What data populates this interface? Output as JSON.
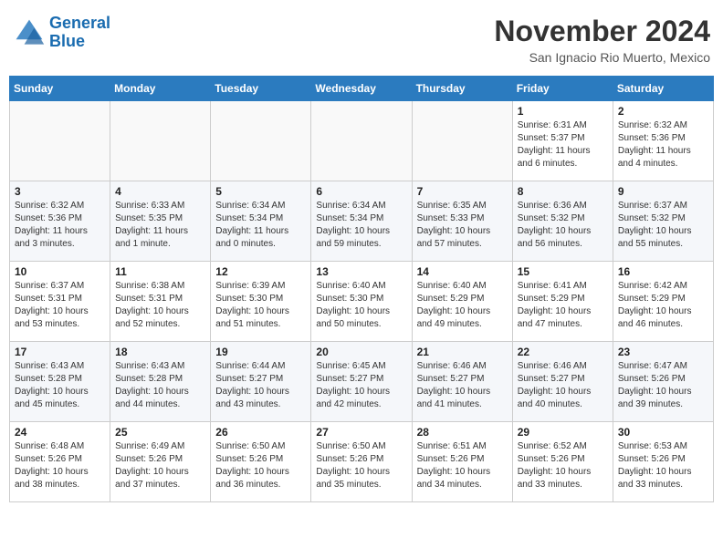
{
  "header": {
    "logo_line1": "General",
    "logo_line2": "Blue",
    "month": "November 2024",
    "location": "San Ignacio Rio Muerto, Mexico"
  },
  "weekdays": [
    "Sunday",
    "Monday",
    "Tuesday",
    "Wednesday",
    "Thursday",
    "Friday",
    "Saturday"
  ],
  "weeks": [
    [
      {
        "day": "",
        "info": ""
      },
      {
        "day": "",
        "info": ""
      },
      {
        "day": "",
        "info": ""
      },
      {
        "day": "",
        "info": ""
      },
      {
        "day": "",
        "info": ""
      },
      {
        "day": "1",
        "info": "Sunrise: 6:31 AM\nSunset: 5:37 PM\nDaylight: 11 hours and 6 minutes."
      },
      {
        "day": "2",
        "info": "Sunrise: 6:32 AM\nSunset: 5:36 PM\nDaylight: 11 hours and 4 minutes."
      }
    ],
    [
      {
        "day": "3",
        "info": "Sunrise: 6:32 AM\nSunset: 5:36 PM\nDaylight: 11 hours and 3 minutes."
      },
      {
        "day": "4",
        "info": "Sunrise: 6:33 AM\nSunset: 5:35 PM\nDaylight: 11 hours and 1 minute."
      },
      {
        "day": "5",
        "info": "Sunrise: 6:34 AM\nSunset: 5:34 PM\nDaylight: 11 hours and 0 minutes."
      },
      {
        "day": "6",
        "info": "Sunrise: 6:34 AM\nSunset: 5:34 PM\nDaylight: 10 hours and 59 minutes."
      },
      {
        "day": "7",
        "info": "Sunrise: 6:35 AM\nSunset: 5:33 PM\nDaylight: 10 hours and 57 minutes."
      },
      {
        "day": "8",
        "info": "Sunrise: 6:36 AM\nSunset: 5:32 PM\nDaylight: 10 hours and 56 minutes."
      },
      {
        "day": "9",
        "info": "Sunrise: 6:37 AM\nSunset: 5:32 PM\nDaylight: 10 hours and 55 minutes."
      }
    ],
    [
      {
        "day": "10",
        "info": "Sunrise: 6:37 AM\nSunset: 5:31 PM\nDaylight: 10 hours and 53 minutes."
      },
      {
        "day": "11",
        "info": "Sunrise: 6:38 AM\nSunset: 5:31 PM\nDaylight: 10 hours and 52 minutes."
      },
      {
        "day": "12",
        "info": "Sunrise: 6:39 AM\nSunset: 5:30 PM\nDaylight: 10 hours and 51 minutes."
      },
      {
        "day": "13",
        "info": "Sunrise: 6:40 AM\nSunset: 5:30 PM\nDaylight: 10 hours and 50 minutes."
      },
      {
        "day": "14",
        "info": "Sunrise: 6:40 AM\nSunset: 5:29 PM\nDaylight: 10 hours and 49 minutes."
      },
      {
        "day": "15",
        "info": "Sunrise: 6:41 AM\nSunset: 5:29 PM\nDaylight: 10 hours and 47 minutes."
      },
      {
        "day": "16",
        "info": "Sunrise: 6:42 AM\nSunset: 5:29 PM\nDaylight: 10 hours and 46 minutes."
      }
    ],
    [
      {
        "day": "17",
        "info": "Sunrise: 6:43 AM\nSunset: 5:28 PM\nDaylight: 10 hours and 45 minutes."
      },
      {
        "day": "18",
        "info": "Sunrise: 6:43 AM\nSunset: 5:28 PM\nDaylight: 10 hours and 44 minutes."
      },
      {
        "day": "19",
        "info": "Sunrise: 6:44 AM\nSunset: 5:27 PM\nDaylight: 10 hours and 43 minutes."
      },
      {
        "day": "20",
        "info": "Sunrise: 6:45 AM\nSunset: 5:27 PM\nDaylight: 10 hours and 42 minutes."
      },
      {
        "day": "21",
        "info": "Sunrise: 6:46 AM\nSunset: 5:27 PM\nDaylight: 10 hours and 41 minutes."
      },
      {
        "day": "22",
        "info": "Sunrise: 6:46 AM\nSunset: 5:27 PM\nDaylight: 10 hours and 40 minutes."
      },
      {
        "day": "23",
        "info": "Sunrise: 6:47 AM\nSunset: 5:26 PM\nDaylight: 10 hours and 39 minutes."
      }
    ],
    [
      {
        "day": "24",
        "info": "Sunrise: 6:48 AM\nSunset: 5:26 PM\nDaylight: 10 hours and 38 minutes."
      },
      {
        "day": "25",
        "info": "Sunrise: 6:49 AM\nSunset: 5:26 PM\nDaylight: 10 hours and 37 minutes."
      },
      {
        "day": "26",
        "info": "Sunrise: 6:50 AM\nSunset: 5:26 PM\nDaylight: 10 hours and 36 minutes."
      },
      {
        "day": "27",
        "info": "Sunrise: 6:50 AM\nSunset: 5:26 PM\nDaylight: 10 hours and 35 minutes."
      },
      {
        "day": "28",
        "info": "Sunrise: 6:51 AM\nSunset: 5:26 PM\nDaylight: 10 hours and 34 minutes."
      },
      {
        "day": "29",
        "info": "Sunrise: 6:52 AM\nSunset: 5:26 PM\nDaylight: 10 hours and 33 minutes."
      },
      {
        "day": "30",
        "info": "Sunrise: 6:53 AM\nSunset: 5:26 PM\nDaylight: 10 hours and 33 minutes."
      }
    ]
  ]
}
